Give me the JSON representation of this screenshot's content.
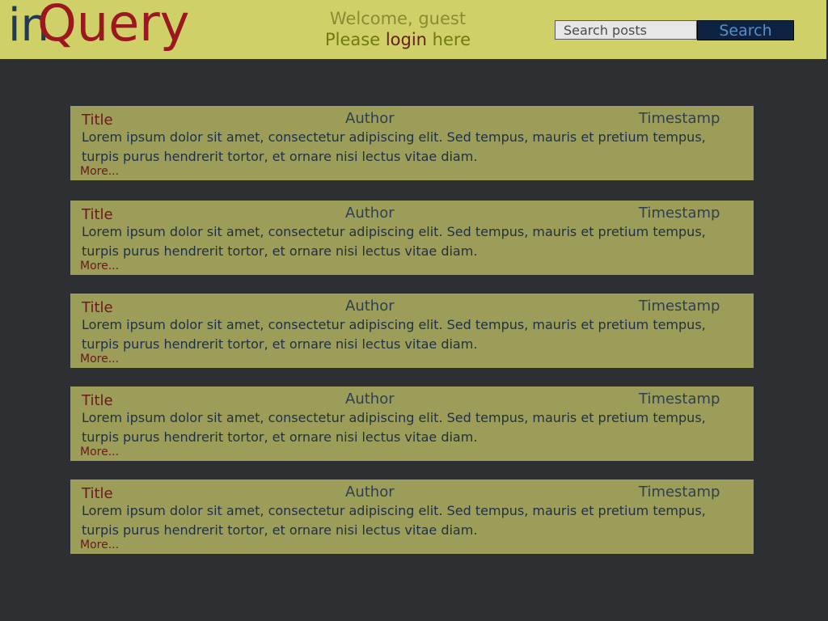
{
  "header": {
    "logo_in": "in",
    "logo_query": "Query",
    "welcome_text": "Welcome, guest",
    "login_prefix": "Please ",
    "login_link": "login",
    "login_suffix": " here"
  },
  "search": {
    "placeholder": "Search posts",
    "button_label": "Search"
  },
  "posts": [
    {
      "title": "Title",
      "author": "Author",
      "timestamp": "Timestamp",
      "body": "Lorem ipsum dolor sit amet, consectetur adipiscing elit. Sed tempus, mauris et pretium tempus, turpis purus hendrerit tortor, et ornare nisi lectus vitae diam.",
      "more": "More..."
    },
    {
      "title": "Title",
      "author": "Author",
      "timestamp": "Timestamp",
      "body": "Lorem ipsum dolor sit amet, consectetur adipiscing elit. Sed tempus, mauris et pretium tempus, turpis purus hendrerit tortor, et ornare nisi lectus vitae diam.",
      "more": "More..."
    },
    {
      "title": "Title",
      "author": "Author",
      "timestamp": "Timestamp",
      "body": "Lorem ipsum dolor sit amet, consectetur adipiscing elit. Sed tempus, mauris et pretium tempus, turpis purus hendrerit tortor, et ornare nisi lectus vitae diam.",
      "more": "More..."
    },
    {
      "title": "Title",
      "author": "Author",
      "timestamp": "Timestamp",
      "body": "Lorem ipsum dolor sit amet, consectetur adipiscing elit. Sed tempus, mauris et pretium tempus, turpis purus hendrerit tortor, et ornare nisi lectus vitae diam.",
      "more": "More..."
    },
    {
      "title": "Title",
      "author": "Author",
      "timestamp": "Timestamp",
      "body": "Lorem ipsum dolor sit amet, consectetur adipiscing elit. Sed tempus, mauris et pretium tempus, turpis purus hendrerit tortor, et ornare nisi lectus vitae diam.",
      "more": "More..."
    }
  ],
  "colors": {
    "header_bg": "#cfd168",
    "page_bg": "#2e2f32",
    "post_bg": "#9c9d58",
    "logo_in": "#22395a",
    "logo_query": "#9c1821",
    "search_button_bg": "#0d2341"
  }
}
